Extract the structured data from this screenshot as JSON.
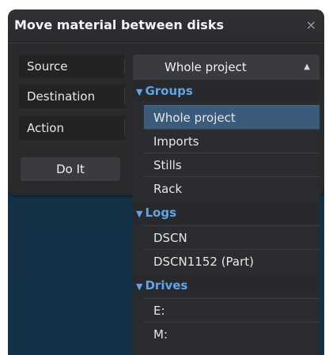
{
  "dialog": {
    "title": "Move material between disks",
    "close_glyph": "×",
    "labels": {
      "source": "Source",
      "destination": "Destination",
      "action": "Action"
    },
    "do_it_label": "Do It"
  },
  "source_select": {
    "value": "Whole project",
    "arrow_glyph": "▲",
    "arrow_icon": "triangle-up-icon"
  },
  "dropdown": {
    "groups": [
      {
        "label": "Groups",
        "arrow": "▼",
        "items": [
          "Whole project",
          "Imports",
          "Stills",
          "Rack"
        ],
        "selected_index": 0
      },
      {
        "label": "Logs",
        "arrow": "▼",
        "items": [
          "DSCN",
          "DSCN1152 (Part)"
        ]
      },
      {
        "label": "Drives",
        "arrow": "▼",
        "items": [
          "E:",
          "M:"
        ]
      }
    ]
  },
  "colors": {
    "group_header": "#5ea6e8",
    "selected_item": "#3a5b7b",
    "panel": "#2a2a2d",
    "background": "#143045"
  }
}
